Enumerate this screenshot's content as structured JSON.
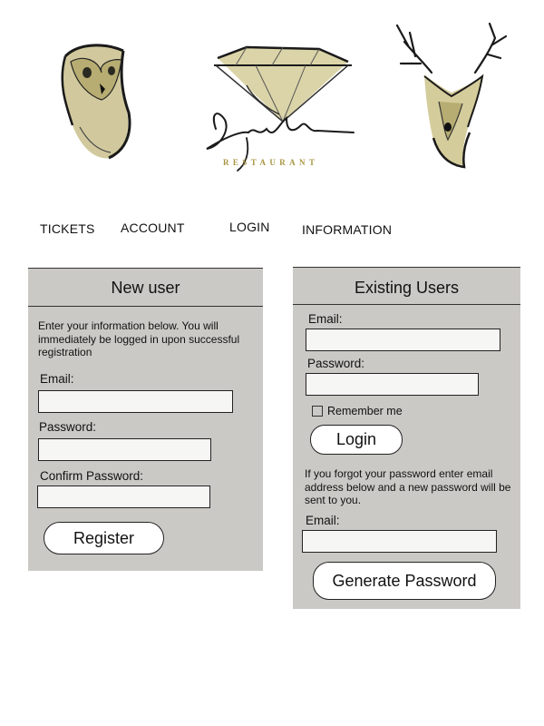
{
  "brand": {
    "wordmark": "RESTAURANT",
    "icons": [
      "owl-icon",
      "diamond-signature-logo",
      "deer-icon"
    ],
    "colors": {
      "accent": "#a89540",
      "sketch_fill": "#c9c08c",
      "panel": "#cbc9c5"
    }
  },
  "nav": {
    "items": [
      {
        "label": "TICKETS"
      },
      {
        "label": "ACCOUNT"
      },
      {
        "label": "LOGIN"
      },
      {
        "label": "INFORMATION"
      }
    ]
  },
  "new_user": {
    "title": "New user",
    "intro": "Enter your information below. You will immediately be logged in upon successful registration",
    "email_label": "Email:",
    "email_value": "",
    "password_label": "Password:",
    "password_value": "",
    "confirm_label": "Confirm Password:",
    "confirm_value": "",
    "register_label": "Register"
  },
  "existing_users": {
    "title": "Existing Users",
    "email_label": "Email:",
    "email_value": "",
    "password_label": "Password:",
    "password_value": "",
    "remember_label": "Remember me",
    "login_label": "Login",
    "forgot_text": "If you forgot your password enter email address below and a new password will be sent to you.",
    "reset_email_label": "Email:",
    "reset_email_value": "",
    "generate_label": "Generate Password"
  }
}
